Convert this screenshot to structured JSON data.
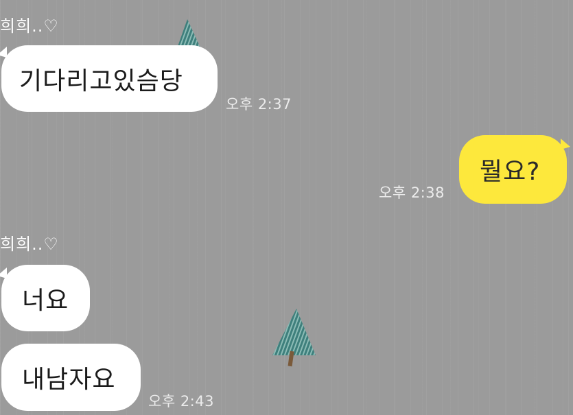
{
  "colors": {
    "background": "#9b9b9b",
    "received_bubble": "#ffffff",
    "sent_bubble": "#fde83c",
    "timestamp": "#ececec"
  },
  "wallpaper_icons": [
    "tree-icon",
    "tree-icon"
  ],
  "messages": [
    {
      "sender": "희희..♡",
      "bubbles": [
        "기다리고있슴당"
      ],
      "time": "오후 2:37"
    },
    {
      "sender": "",
      "bubbles": [
        "뭘요?"
      ],
      "time": "오후 2:38",
      "mine": true
    },
    {
      "sender": "희희..♡",
      "bubbles": [
        "너요",
        "내남자요"
      ],
      "time": "오후 2:43"
    }
  ]
}
